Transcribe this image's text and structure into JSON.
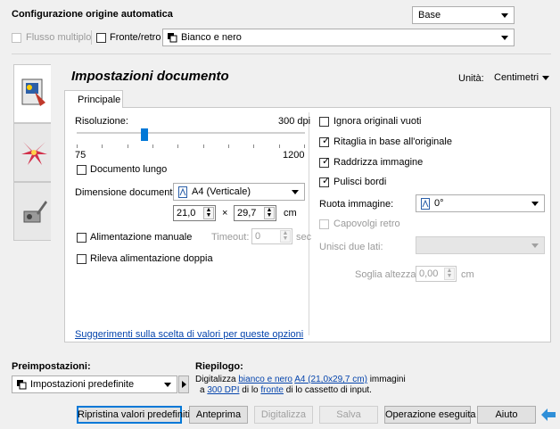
{
  "header": {
    "title": "Configurazione origine automatica",
    "mode_value": "Base",
    "flusso_label": "Flusso multiplo",
    "fronte_label": "Fronte/retro",
    "color_value": "Bianco e nero"
  },
  "side_tabs": [
    "document-settings-icon",
    "image-settings-icon",
    "device-settings-icon"
  ],
  "section": {
    "title": "Impostazioni documento",
    "units_label": "Unità:",
    "units_value": "Centimetri",
    "tab_label": "Principale"
  },
  "left": {
    "resolution_label": "Risoluzione:",
    "resolution_value": "300 dpi",
    "resolution_level": 0.29,
    "slider_min": "75",
    "slider_max": "1200",
    "doc_lungo_label": "Documento lungo",
    "dimension_label": "Dimensione documento:",
    "dimension_value": "A4 (Verticale)",
    "width_value": "21,0",
    "times": "×",
    "height_value": "29,7",
    "unit": "cm",
    "manual_feed_label": "Alimentazione manuale",
    "timeout_label": "Timeout:",
    "timeout_value": "0",
    "timeout_unit": "sec",
    "double_feed_label": "Rileva alimentazione doppia",
    "suggestion_link": "Suggerimenti sulla scelta di valori per queste opzioni"
  },
  "right": {
    "ignore_blank_label": "Ignora originali vuoti",
    "crop_label": "Ritaglia in base all'originale",
    "straighten_label": "Raddrizza immagine",
    "clean_edges_label": "Pulisci bordi",
    "rotate_label": "Ruota immagine:",
    "rotate_value": "0°",
    "flip_label": "Capovolgi retro",
    "merge_label": "Unisci due lati:",
    "threshold_label": "Soglia altezza:",
    "threshold_value": "0,00",
    "threshold_unit": "cm"
  },
  "footer": {
    "presets_label": "Preimpostazioni:",
    "preset_value": "Impostazioni predefinite",
    "summary_label": "Riepilogo:",
    "summary_line1_pre": "Digitalizza",
    "summary_color": "bianco e nero",
    "summary_size": "A4 (21,0x29,7 cm)",
    "summary_line1_post": "immagini",
    "summary_line2_pre": "a",
    "summary_dpi": "300 DPI",
    "summary_line2_mid": "di lo",
    "summary_side": "fronte",
    "summary_line2_post": "di lo cassetto di input.",
    "buttons": [
      "Ripristina valori predefiniti",
      "Anteprima",
      "Digitalizza",
      "Salva",
      "Operazione eseguita",
      "Aiuto"
    ]
  }
}
